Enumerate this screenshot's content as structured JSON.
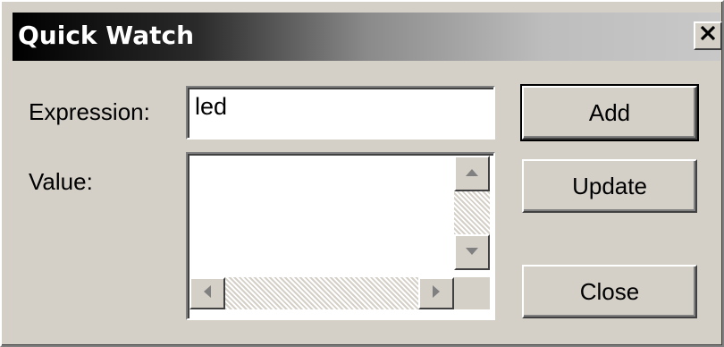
{
  "window": {
    "title": "Quick Watch",
    "close_glyph": "✕"
  },
  "form": {
    "expression_label": "Expression:",
    "expression_value": "led",
    "value_label": "Value:"
  },
  "buttons": {
    "add": "Add",
    "update": "Update",
    "close": "Close"
  },
  "icons": {
    "close": "close-icon",
    "scroll_up": "arrow-up-icon",
    "scroll_down": "arrow-down-icon",
    "scroll_left": "arrow-left-icon",
    "scroll_right": "arrow-right-icon"
  }
}
